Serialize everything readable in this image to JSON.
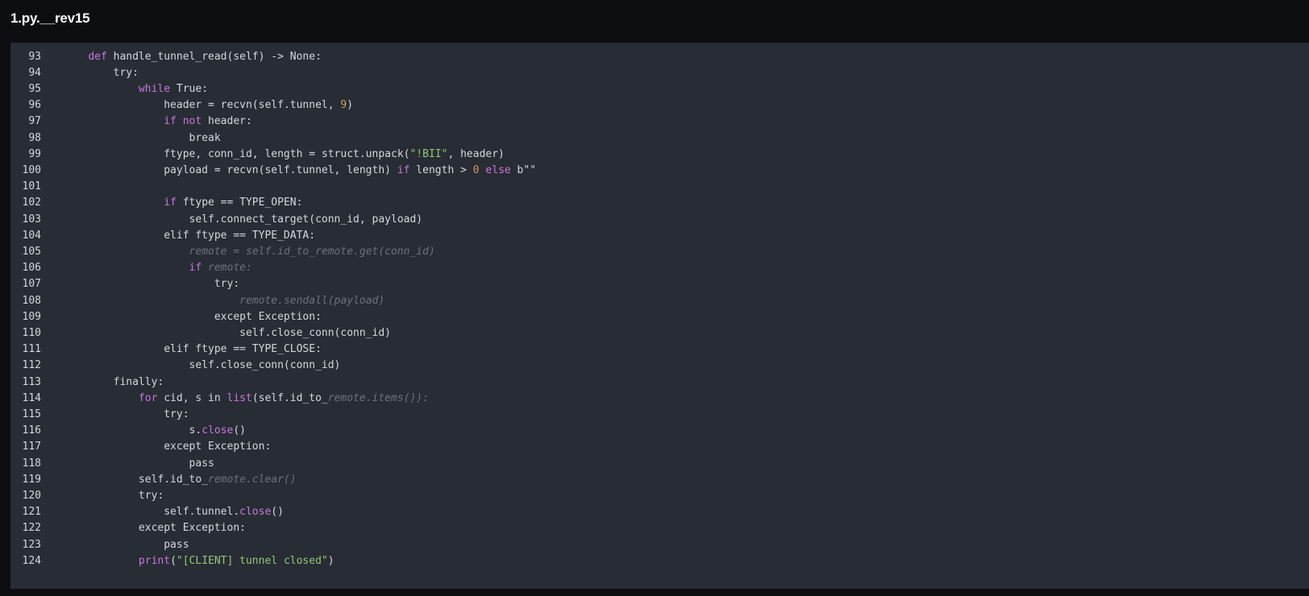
{
  "window": {
    "title": "1.py.__rev15"
  },
  "editor": {
    "partial_top_line": "92",
    "lines": [
      {
        "n": "93",
        "tokens": [
          [
            "    ",
            ""
          ],
          [
            "def",
            "kw"
          ],
          [
            " handle_tunnel_read(self) -> None:",
            ""
          ]
        ]
      },
      {
        "n": "94",
        "tokens": [
          [
            "        try:",
            ""
          ]
        ]
      },
      {
        "n": "95",
        "tokens": [
          [
            "            ",
            ""
          ],
          [
            "while",
            "kw"
          ],
          [
            " True:",
            ""
          ]
        ]
      },
      {
        "n": "96",
        "tokens": [
          [
            "                header = recvn(self.tunnel, ",
            ""
          ],
          [
            "9",
            "num"
          ],
          [
            ")",
            ""
          ]
        ]
      },
      {
        "n": "97",
        "tokens": [
          [
            "                ",
            ""
          ],
          [
            "if",
            "kw"
          ],
          [
            " ",
            ""
          ],
          [
            "not",
            "kw"
          ],
          [
            " header:",
            ""
          ]
        ]
      },
      {
        "n": "98",
        "tokens": [
          [
            "                    break",
            ""
          ]
        ]
      },
      {
        "n": "99",
        "tokens": [
          [
            "                ftype, conn_id, length = struct.unpack(",
            ""
          ],
          [
            "\"!BII\"",
            "str"
          ],
          [
            ", header)",
            ""
          ]
        ]
      },
      {
        "n": "100",
        "tokens": [
          [
            "                payload = recvn(self.tunnel, length) ",
            ""
          ],
          [
            "if",
            "kw"
          ],
          [
            " length > ",
            ""
          ],
          [
            "0",
            "num"
          ],
          [
            " ",
            ""
          ],
          [
            "else",
            "kw"
          ],
          [
            " b\"\"",
            ""
          ]
        ]
      },
      {
        "n": "101",
        "tokens": [
          [
            "",
            ""
          ]
        ]
      },
      {
        "n": "102",
        "tokens": [
          [
            "                ",
            ""
          ],
          [
            "if",
            "kw"
          ],
          [
            " ftype == TYPE_OPEN:",
            ""
          ]
        ]
      },
      {
        "n": "103",
        "tokens": [
          [
            "                    self.connect_target(conn_id, payload)",
            ""
          ]
        ]
      },
      {
        "n": "104",
        "tokens": [
          [
            "                elif ftype == TYPE_DATA:",
            ""
          ]
        ]
      },
      {
        "n": "105",
        "tokens": [
          [
            "                    ",
            ""
          ],
          [
            "remote = self.id_to_remote.get(conn_id)",
            "cm"
          ]
        ]
      },
      {
        "n": "106",
        "tokens": [
          [
            "                    ",
            ""
          ],
          [
            "if",
            "kw"
          ],
          [
            " ",
            ""
          ],
          [
            "remote:",
            "cm"
          ]
        ]
      },
      {
        "n": "107",
        "tokens": [
          [
            "                        try:",
            ""
          ]
        ]
      },
      {
        "n": "108",
        "tokens": [
          [
            "                            ",
            ""
          ],
          [
            "remote.sendall(payload)",
            "cm"
          ]
        ]
      },
      {
        "n": "109",
        "tokens": [
          [
            "                        except Exception:",
            ""
          ]
        ]
      },
      {
        "n": "110",
        "tokens": [
          [
            "                            self.close_conn(conn_id)",
            ""
          ]
        ]
      },
      {
        "n": "111",
        "tokens": [
          [
            "                elif ftype == TYPE_CLOSE:",
            ""
          ]
        ]
      },
      {
        "n": "112",
        "tokens": [
          [
            "                    self.close_conn(conn_id)",
            ""
          ]
        ]
      },
      {
        "n": "113",
        "tokens": [
          [
            "        finally:",
            ""
          ]
        ]
      },
      {
        "n": "114",
        "tokens": [
          [
            "            ",
            ""
          ],
          [
            "for",
            "kw"
          ],
          [
            " cid, s in ",
            ""
          ],
          [
            "list",
            "kw"
          ],
          [
            "(self.id_to_",
            ""
          ],
          [
            "remote.items()):",
            "cm"
          ]
        ]
      },
      {
        "n": "115",
        "tokens": [
          [
            "                try:",
            ""
          ]
        ]
      },
      {
        "n": "116",
        "tokens": [
          [
            "                    s.",
            ""
          ],
          [
            "close",
            "kw"
          ],
          [
            "()",
            ""
          ]
        ]
      },
      {
        "n": "117",
        "tokens": [
          [
            "                except Exception:",
            ""
          ]
        ]
      },
      {
        "n": "118",
        "tokens": [
          [
            "                    pass",
            ""
          ]
        ]
      },
      {
        "n": "119",
        "tokens": [
          [
            "            self.id_to_",
            ""
          ],
          [
            "remote.clear()",
            "cm"
          ]
        ]
      },
      {
        "n": "120",
        "tokens": [
          [
            "            try:",
            ""
          ]
        ]
      },
      {
        "n": "121",
        "tokens": [
          [
            "                self.tunnel.",
            ""
          ],
          [
            "close",
            "kw"
          ],
          [
            "()",
            ""
          ]
        ]
      },
      {
        "n": "122",
        "tokens": [
          [
            "            except Exception:",
            ""
          ]
        ]
      },
      {
        "n": "123",
        "tokens": [
          [
            "                pass",
            ""
          ]
        ]
      },
      {
        "n": "124",
        "tokens": [
          [
            "            ",
            ""
          ],
          [
            "print",
            "kw"
          ],
          [
            "(",
            ""
          ],
          [
            "\"[CLIENT] tunnel closed\"",
            "str"
          ],
          [
            ")",
            ""
          ]
        ]
      }
    ]
  }
}
